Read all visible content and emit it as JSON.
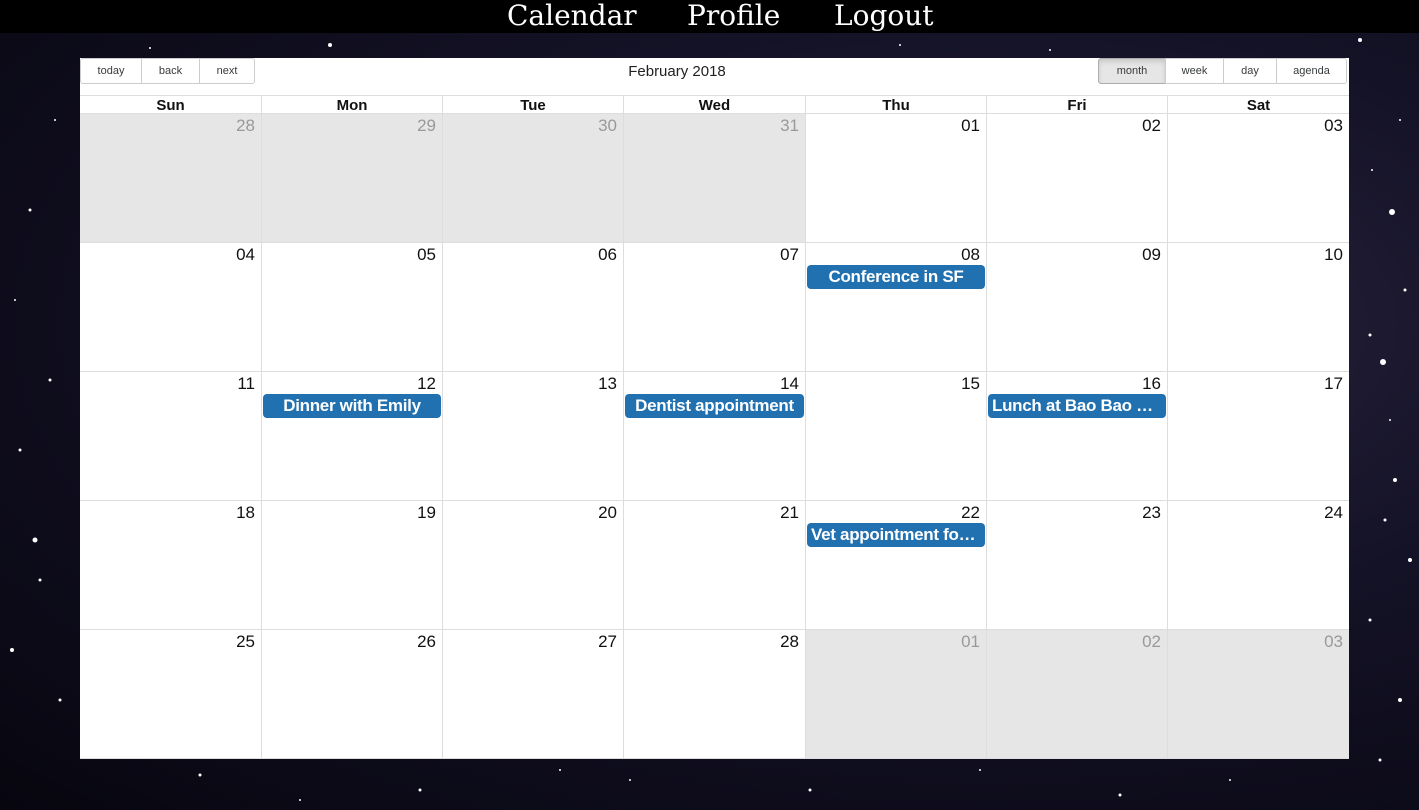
{
  "nav": {
    "items": [
      {
        "label": "Calendar"
      },
      {
        "label": "Profile"
      },
      {
        "label": "Logout"
      }
    ]
  },
  "toolbar": {
    "today": "today",
    "back": "back",
    "next": "next",
    "label": "February 2018",
    "views": [
      "month",
      "week",
      "day",
      "agenda"
    ],
    "active_view": "month"
  },
  "weekdays": [
    "Sun",
    "Mon",
    "Tue",
    "Wed",
    "Thu",
    "Fri",
    "Sat"
  ],
  "weeks": [
    {
      "days": [
        {
          "num": "28",
          "off": true
        },
        {
          "num": "29",
          "off": true
        },
        {
          "num": "30",
          "off": true
        },
        {
          "num": "31",
          "off": true
        },
        {
          "num": "01"
        },
        {
          "num": "02"
        },
        {
          "num": "03"
        }
      ]
    },
    {
      "days": [
        {
          "num": "04"
        },
        {
          "num": "05"
        },
        {
          "num": "06"
        },
        {
          "num": "07"
        },
        {
          "num": "08",
          "event": "Conference in SF"
        },
        {
          "num": "09"
        },
        {
          "num": "10"
        }
      ]
    },
    {
      "days": [
        {
          "num": "11"
        },
        {
          "num": "12",
          "event": "Dinner with Emily"
        },
        {
          "num": "13"
        },
        {
          "num": "14",
          "event": "Dentist appointment"
        },
        {
          "num": "15"
        },
        {
          "num": "16",
          "event": "Lunch at Bao Bao Ca..."
        },
        {
          "num": "17"
        }
      ]
    },
    {
      "days": [
        {
          "num": "18"
        },
        {
          "num": "19"
        },
        {
          "num": "20"
        },
        {
          "num": "21"
        },
        {
          "num": "22",
          "event": "Vet appointment for ..."
        },
        {
          "num": "23"
        },
        {
          "num": "24"
        }
      ]
    },
    {
      "days": [
        {
          "num": "25"
        },
        {
          "num": "26"
        },
        {
          "num": "27"
        },
        {
          "num": "28"
        },
        {
          "num": "01",
          "off": true
        },
        {
          "num": "02",
          "off": true
        },
        {
          "num": "03",
          "off": true
        }
      ]
    }
  ],
  "colors": {
    "event_bg": "#2170b0",
    "off_range_bg": "#e6e6e6",
    "nav_bg": "#000000"
  }
}
